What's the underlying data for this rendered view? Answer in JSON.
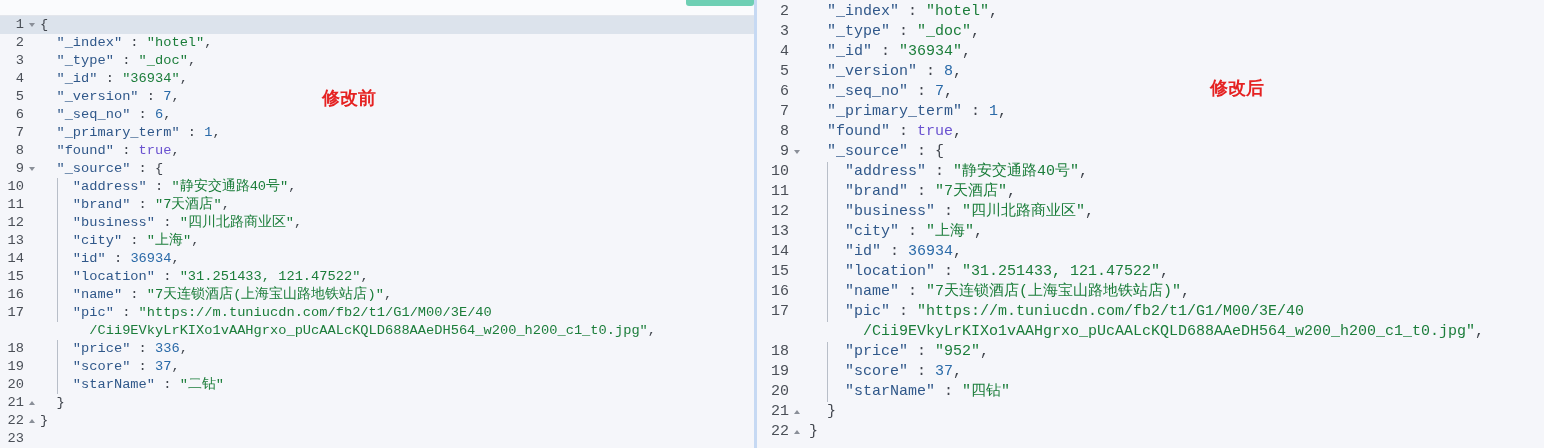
{
  "panes": [
    {
      "annotation": "修改前",
      "scrolled": false,
      "lines": [
        {
          "number": "1",
          "foldable": true,
          "fold_end": false,
          "active": true,
          "guide": false,
          "tokens": [
            {
              "kind": "punct",
              "text": "{"
            }
          ]
        },
        {
          "number": "2",
          "foldable": false,
          "fold_end": false,
          "active": false,
          "guide": false,
          "tokens": [
            {
              "kind": "key",
              "text": "  \"_index\""
            },
            {
              "kind": "punct",
              "text": " : "
            },
            {
              "kind": "string",
              "text": "\"hotel\""
            },
            {
              "kind": "punct",
              "text": ","
            }
          ]
        },
        {
          "number": "3",
          "foldable": false,
          "fold_end": false,
          "active": false,
          "guide": false,
          "tokens": [
            {
              "kind": "key",
              "text": "  \"_type\""
            },
            {
              "kind": "punct",
              "text": " : "
            },
            {
              "kind": "string",
              "text": "\"_doc\""
            },
            {
              "kind": "punct",
              "text": ","
            }
          ]
        },
        {
          "number": "4",
          "foldable": false,
          "fold_end": false,
          "active": false,
          "guide": false,
          "tokens": [
            {
              "kind": "key",
              "text": "  \"_id\""
            },
            {
              "kind": "punct",
              "text": " : "
            },
            {
              "kind": "string",
              "text": "\"36934\""
            },
            {
              "kind": "punct",
              "text": ","
            }
          ]
        },
        {
          "number": "5",
          "foldable": false,
          "fold_end": false,
          "active": false,
          "guide": false,
          "tokens": [
            {
              "kind": "key",
              "text": "  \"_version\""
            },
            {
              "kind": "punct",
              "text": " : "
            },
            {
              "kind": "number",
              "text": "7"
            },
            {
              "kind": "punct",
              "text": ","
            }
          ]
        },
        {
          "number": "6",
          "foldable": false,
          "fold_end": false,
          "active": false,
          "guide": false,
          "tokens": [
            {
              "kind": "key",
              "text": "  \"_seq_no\""
            },
            {
              "kind": "punct",
              "text": " : "
            },
            {
              "kind": "number",
              "text": "6"
            },
            {
              "kind": "punct",
              "text": ","
            }
          ]
        },
        {
          "number": "7",
          "foldable": false,
          "fold_end": false,
          "active": false,
          "guide": false,
          "tokens": [
            {
              "kind": "key",
              "text": "  \"_primary_term\""
            },
            {
              "kind": "punct",
              "text": " : "
            },
            {
              "kind": "number",
              "text": "1"
            },
            {
              "kind": "punct",
              "text": ","
            }
          ]
        },
        {
          "number": "8",
          "foldable": false,
          "fold_end": false,
          "active": false,
          "guide": false,
          "tokens": [
            {
              "kind": "key",
              "text": "  \"found\""
            },
            {
              "kind": "punct",
              "text": " : "
            },
            {
              "kind": "boolean",
              "text": "true"
            },
            {
              "kind": "punct",
              "text": ","
            }
          ]
        },
        {
          "number": "9",
          "foldable": true,
          "fold_end": false,
          "active": false,
          "guide": false,
          "tokens": [
            {
              "kind": "key",
              "text": "  \"_source\""
            },
            {
              "kind": "punct",
              "text": " : {"
            }
          ]
        },
        {
          "number": "10",
          "foldable": false,
          "fold_end": false,
          "active": false,
          "guide": true,
          "tokens": [
            {
              "kind": "key",
              "text": "    \"address\""
            },
            {
              "kind": "punct",
              "text": " : "
            },
            {
              "kind": "string",
              "text": "\"静安交通路40号\""
            },
            {
              "kind": "punct",
              "text": ","
            }
          ]
        },
        {
          "number": "11",
          "foldable": false,
          "fold_end": false,
          "active": false,
          "guide": true,
          "tokens": [
            {
              "kind": "key",
              "text": "    \"brand\""
            },
            {
              "kind": "punct",
              "text": " : "
            },
            {
              "kind": "string",
              "text": "\"7天酒店\""
            },
            {
              "kind": "punct",
              "text": ","
            }
          ]
        },
        {
          "number": "12",
          "foldable": false,
          "fold_end": false,
          "active": false,
          "guide": true,
          "tokens": [
            {
              "kind": "key",
              "text": "    \"business\""
            },
            {
              "kind": "punct",
              "text": " : "
            },
            {
              "kind": "string",
              "text": "\"四川北路商业区\""
            },
            {
              "kind": "punct",
              "text": ","
            }
          ]
        },
        {
          "number": "13",
          "foldable": false,
          "fold_end": false,
          "active": false,
          "guide": true,
          "tokens": [
            {
              "kind": "key",
              "text": "    \"city\""
            },
            {
              "kind": "punct",
              "text": " : "
            },
            {
              "kind": "string",
              "text": "\"上海\""
            },
            {
              "kind": "punct",
              "text": ","
            }
          ]
        },
        {
          "number": "14",
          "foldable": false,
          "fold_end": false,
          "active": false,
          "guide": true,
          "tokens": [
            {
              "kind": "key",
              "text": "    \"id\""
            },
            {
              "kind": "punct",
              "text": " : "
            },
            {
              "kind": "number",
              "text": "36934"
            },
            {
              "kind": "punct",
              "text": ","
            }
          ]
        },
        {
          "number": "15",
          "foldable": false,
          "fold_end": false,
          "active": false,
          "guide": true,
          "tokens": [
            {
              "kind": "key",
              "text": "    \"location\""
            },
            {
              "kind": "punct",
              "text": " : "
            },
            {
              "kind": "string",
              "text": "\"31.251433, 121.47522\""
            },
            {
              "kind": "punct",
              "text": ","
            }
          ]
        },
        {
          "number": "16",
          "foldable": false,
          "fold_end": false,
          "active": false,
          "guide": true,
          "tokens": [
            {
              "kind": "key",
              "text": "    \"name\""
            },
            {
              "kind": "punct",
              "text": " : "
            },
            {
              "kind": "string",
              "text": "\"7天连锁酒店(上海宝山路地铁站店)\""
            },
            {
              "kind": "punct",
              "text": ","
            }
          ]
        },
        {
          "number": "17",
          "foldable": false,
          "fold_end": false,
          "active": false,
          "guide": true,
          "tokens": [
            {
              "kind": "key",
              "text": "    \"pic\""
            },
            {
              "kind": "punct",
              "text": " : "
            },
            {
              "kind": "string",
              "text": "\"https://m.tuniucdn.com/fb2/t1/G1/M00/3E/40"
            }
          ],
          "wrapped": [
            {
              "kind": "string",
              "text": "      /Cii9EVkyLrKIXo1vAAHgrxo_pUcAALcKQLD688AAeDH564_w200_h200_c1_t0.jpg\""
            },
            {
              "kind": "punct",
              "text": ","
            }
          ]
        },
        {
          "number": "18",
          "foldable": false,
          "fold_end": false,
          "active": false,
          "guide": true,
          "tokens": [
            {
              "kind": "key",
              "text": "    \"price\""
            },
            {
              "kind": "punct",
              "text": " : "
            },
            {
              "kind": "number",
              "text": "336"
            },
            {
              "kind": "punct",
              "text": ","
            }
          ]
        },
        {
          "number": "19",
          "foldable": false,
          "fold_end": false,
          "active": false,
          "guide": true,
          "tokens": [
            {
              "kind": "key",
              "text": "    \"score\""
            },
            {
              "kind": "punct",
              "text": " : "
            },
            {
              "kind": "number",
              "text": "37"
            },
            {
              "kind": "punct",
              "text": ","
            }
          ]
        },
        {
          "number": "20",
          "foldable": false,
          "fold_end": false,
          "active": false,
          "guide": true,
          "tokens": [
            {
              "kind": "key",
              "text": "    \"starName\""
            },
            {
              "kind": "punct",
              "text": " : "
            },
            {
              "kind": "string",
              "text": "\"二钻\""
            }
          ]
        },
        {
          "number": "21",
          "foldable": false,
          "fold_end": true,
          "active": false,
          "guide": false,
          "tokens": [
            {
              "kind": "punct",
              "text": "  }"
            }
          ]
        },
        {
          "number": "22",
          "foldable": false,
          "fold_end": true,
          "active": false,
          "guide": false,
          "tokens": [
            {
              "kind": "punct",
              "text": "}"
            }
          ]
        },
        {
          "number": "23",
          "foldable": false,
          "fold_end": false,
          "active": false,
          "guide": false
        }
      ]
    },
    {
      "annotation": "修改后",
      "scrolled": true,
      "lines": [
        {
          "number": "2",
          "foldable": false,
          "fold_end": false,
          "active": false,
          "guide": false,
          "tokens": [
            {
              "kind": "key",
              "text": "  \"_index\""
            },
            {
              "kind": "punct",
              "text": " : "
            },
            {
              "kind": "string",
              "text": "\"hotel\""
            },
            {
              "kind": "punct",
              "text": ","
            }
          ]
        },
        {
          "number": "3",
          "foldable": false,
          "fold_end": false,
          "active": false,
          "guide": false,
          "tokens": [
            {
              "kind": "key",
              "text": "  \"_type\""
            },
            {
              "kind": "punct",
              "text": " : "
            },
            {
              "kind": "string",
              "text": "\"_doc\""
            },
            {
              "kind": "punct",
              "text": ","
            }
          ]
        },
        {
          "number": "4",
          "foldable": false,
          "fold_end": false,
          "active": false,
          "guide": false,
          "tokens": [
            {
              "kind": "key",
              "text": "  \"_id\""
            },
            {
              "kind": "punct",
              "text": " : "
            },
            {
              "kind": "string",
              "text": "\"36934\""
            },
            {
              "kind": "punct",
              "text": ","
            }
          ]
        },
        {
          "number": "5",
          "foldable": false,
          "fold_end": false,
          "active": false,
          "guide": false,
          "tokens": [
            {
              "kind": "key",
              "text": "  \"_version\""
            },
            {
              "kind": "punct",
              "text": " : "
            },
            {
              "kind": "number",
              "text": "8"
            },
            {
              "kind": "punct",
              "text": ","
            }
          ]
        },
        {
          "number": "6",
          "foldable": false,
          "fold_end": false,
          "active": false,
          "guide": false,
          "tokens": [
            {
              "kind": "key",
              "text": "  \"_seq_no\""
            },
            {
              "kind": "punct",
              "text": " : "
            },
            {
              "kind": "number",
              "text": "7"
            },
            {
              "kind": "punct",
              "text": ","
            }
          ]
        },
        {
          "number": "7",
          "foldable": false,
          "fold_end": false,
          "active": false,
          "guide": false,
          "tokens": [
            {
              "kind": "key",
              "text": "  \"_primary_term\""
            },
            {
              "kind": "punct",
              "text": " : "
            },
            {
              "kind": "number",
              "text": "1"
            },
            {
              "kind": "punct",
              "text": ","
            }
          ]
        },
        {
          "number": "8",
          "foldable": false,
          "fold_end": false,
          "active": false,
          "guide": false,
          "tokens": [
            {
              "kind": "key",
              "text": "  \"found\""
            },
            {
              "kind": "punct",
              "text": " : "
            },
            {
              "kind": "boolean",
              "text": "true"
            },
            {
              "kind": "punct",
              "text": ","
            }
          ]
        },
        {
          "number": "9",
          "foldable": true,
          "fold_end": false,
          "active": false,
          "guide": false,
          "tokens": [
            {
              "kind": "key",
              "text": "  \"_source\""
            },
            {
              "kind": "punct",
              "text": " : {"
            }
          ]
        },
        {
          "number": "10",
          "foldable": false,
          "fold_end": false,
          "active": false,
          "guide": true,
          "tokens": [
            {
              "kind": "key",
              "text": "    \"address\""
            },
            {
              "kind": "punct",
              "text": " : "
            },
            {
              "kind": "string",
              "text": "\"静安交通路40号\""
            },
            {
              "kind": "punct",
              "text": ","
            }
          ]
        },
        {
          "number": "11",
          "foldable": false,
          "fold_end": false,
          "active": false,
          "guide": true,
          "tokens": [
            {
              "kind": "key",
              "text": "    \"brand\""
            },
            {
              "kind": "punct",
              "text": " : "
            },
            {
              "kind": "string",
              "text": "\"7天酒店\""
            },
            {
              "kind": "punct",
              "text": ","
            }
          ]
        },
        {
          "number": "12",
          "foldable": false,
          "fold_end": false,
          "active": false,
          "guide": true,
          "tokens": [
            {
              "kind": "key",
              "text": "    \"business\""
            },
            {
              "kind": "punct",
              "text": " : "
            },
            {
              "kind": "string",
              "text": "\"四川北路商业区\""
            },
            {
              "kind": "punct",
              "text": ","
            }
          ]
        },
        {
          "number": "13",
          "foldable": false,
          "fold_end": false,
          "active": false,
          "guide": true,
          "tokens": [
            {
              "kind": "key",
              "text": "    \"city\""
            },
            {
              "kind": "punct",
              "text": " : "
            },
            {
              "kind": "string",
              "text": "\"上海\""
            },
            {
              "kind": "punct",
              "text": ","
            }
          ]
        },
        {
          "number": "14",
          "foldable": false,
          "fold_end": false,
          "active": false,
          "guide": true,
          "tokens": [
            {
              "kind": "key",
              "text": "    \"id\""
            },
            {
              "kind": "punct",
              "text": " : "
            },
            {
              "kind": "number",
              "text": "36934"
            },
            {
              "kind": "punct",
              "text": ","
            }
          ]
        },
        {
          "number": "15",
          "foldable": false,
          "fold_end": false,
          "active": false,
          "guide": true,
          "tokens": [
            {
              "kind": "key",
              "text": "    \"location\""
            },
            {
              "kind": "punct",
              "text": " : "
            },
            {
              "kind": "string",
              "text": "\"31.251433, 121.47522\""
            },
            {
              "kind": "punct",
              "text": ","
            }
          ]
        },
        {
          "number": "16",
          "foldable": false,
          "fold_end": false,
          "active": false,
          "guide": true,
          "tokens": [
            {
              "kind": "key",
              "text": "    \"name\""
            },
            {
              "kind": "punct",
              "text": " : "
            },
            {
              "kind": "string",
              "text": "\"7天连锁酒店(上海宝山路地铁站店)\""
            },
            {
              "kind": "punct",
              "text": ","
            }
          ]
        },
        {
          "number": "17",
          "foldable": false,
          "fold_end": false,
          "active": false,
          "guide": true,
          "tokens": [
            {
              "kind": "key",
              "text": "    \"pic\""
            },
            {
              "kind": "punct",
              "text": " : "
            },
            {
              "kind": "string",
              "text": "\"https://m.tuniucdn.com/fb2/t1/G1/M00/3E/40"
            }
          ],
          "wrapped": [
            {
              "kind": "string",
              "text": "      /Cii9EVkyLrKIXo1vAAHgrxo_pUcAALcKQLD688AAeDH564_w200_h200_c1_t0.jpg\""
            },
            {
              "kind": "punct",
              "text": ","
            }
          ]
        },
        {
          "number": "18",
          "foldable": false,
          "fold_end": false,
          "active": false,
          "guide": true,
          "tokens": [
            {
              "kind": "key",
              "text": "    \"price\""
            },
            {
              "kind": "punct",
              "text": " : "
            },
            {
              "kind": "string",
              "text": "\"952\""
            },
            {
              "kind": "punct",
              "text": ","
            }
          ]
        },
        {
          "number": "19",
          "foldable": false,
          "fold_end": false,
          "active": false,
          "guide": true,
          "tokens": [
            {
              "kind": "key",
              "text": "    \"score\""
            },
            {
              "kind": "punct",
              "text": " : "
            },
            {
              "kind": "number",
              "text": "37"
            },
            {
              "kind": "punct",
              "text": ","
            }
          ]
        },
        {
          "number": "20",
          "foldable": false,
          "fold_end": false,
          "active": false,
          "guide": true,
          "tokens": [
            {
              "kind": "key",
              "text": "    \"starName\""
            },
            {
              "kind": "punct",
              "text": " : "
            },
            {
              "kind": "string",
              "text": "\"四钻\""
            }
          ]
        },
        {
          "number": "21",
          "foldable": false,
          "fold_end": true,
          "active": false,
          "guide": false,
          "tokens": [
            {
              "kind": "punct",
              "text": "  }"
            }
          ]
        },
        {
          "number": "22",
          "foldable": false,
          "fold_end": true,
          "active": false,
          "guide": false,
          "tokens": [
            {
              "kind": "punct",
              "text": "}"
            }
          ]
        }
      ]
    }
  ]
}
